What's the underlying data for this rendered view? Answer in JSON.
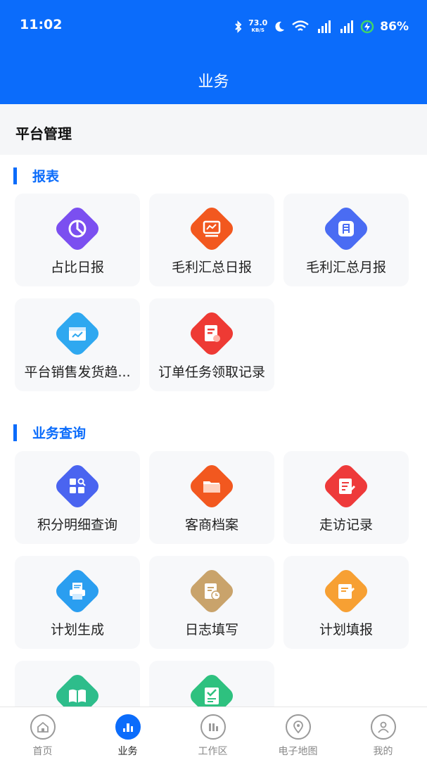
{
  "status_bar": {
    "time": "11:02",
    "net_speed": "73.0",
    "net_unit": "KB/S",
    "battery": "86%",
    "icons": [
      "bluetooth-icon",
      "moon-icon",
      "wifi-icon",
      "signal-5g-icon",
      "signal-5g-icon",
      "charging-icon"
    ]
  },
  "header": {
    "title": "业务"
  },
  "section": {
    "label": "平台管理"
  },
  "groups": [
    {
      "title": "报表",
      "items": [
        {
          "label": "占比日报",
          "icon": "pie-chart-icon",
          "color": "#7b4ff0"
        },
        {
          "label": "毛利汇总日报",
          "icon": "monitor-chart-icon",
          "color": "#f2581f"
        },
        {
          "label": "毛利汇总月报",
          "icon": "calendar-month-icon",
          "color": "#4a6cf3"
        },
        {
          "label": "平台销售发货趋...",
          "icon": "box-trend-icon",
          "color": "#2fa8f0"
        },
        {
          "label": "订单任务领取记录",
          "icon": "order-task-icon",
          "color": "#ee3a34"
        }
      ]
    },
    {
      "title": "业务查询",
      "items": [
        {
          "label": "积分明细查询",
          "icon": "grid-search-icon",
          "color": "#4a64f0"
        },
        {
          "label": "客商档案",
          "icon": "folder-icon",
          "color": "#f2581f"
        },
        {
          "label": "走访记录",
          "icon": "visit-record-icon",
          "color": "#ee3a3a"
        },
        {
          "label": "计划生成",
          "icon": "printer-plan-icon",
          "color": "#2a9ef0"
        },
        {
          "label": "日志填写",
          "icon": "log-clock-icon",
          "color": "#c9a36b"
        },
        {
          "label": "计划填报",
          "icon": "edit-plan-icon",
          "color": "#f7a033"
        },
        {
          "label": "",
          "icon": "book-icon",
          "color": "#2ebd8b"
        },
        {
          "label": "",
          "icon": "checklist-icon",
          "color": "#2ec17f"
        }
      ]
    }
  ],
  "tabbar": [
    {
      "label": "首页",
      "icon": "home-icon",
      "active": false
    },
    {
      "label": "业务",
      "icon": "business-icon",
      "active": true
    },
    {
      "label": "工作区",
      "icon": "workspace-icon",
      "active": false
    },
    {
      "label": "电子地图",
      "icon": "map-pin-icon",
      "active": false
    },
    {
      "label": "我的",
      "icon": "user-icon",
      "active": false
    }
  ],
  "colors": {
    "primary": "#0b6cfb",
    "card_bg": "#f7f8fa",
    "section_bg": "#f5f6f8"
  }
}
